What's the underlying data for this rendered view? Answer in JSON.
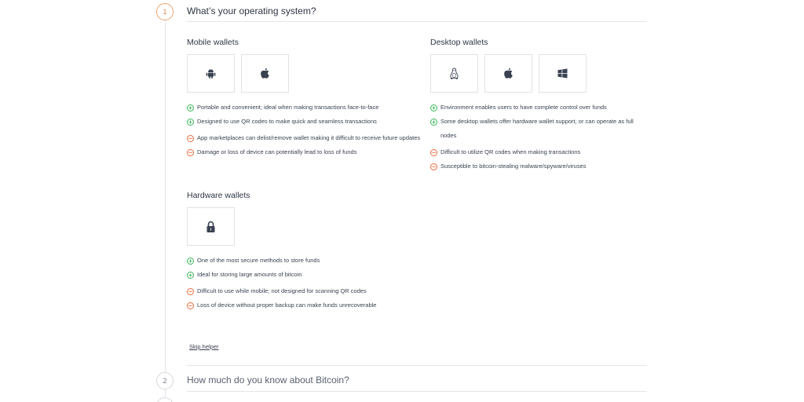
{
  "step1": {
    "number": "1",
    "title": "What’s your operating system?"
  },
  "step2": {
    "number": "2",
    "title": "How much do you know about Bitcoin?"
  },
  "mobile": {
    "title": "Mobile wallets",
    "icons": [
      "android-icon",
      "apple-icon"
    ],
    "pros": [
      "Portable and convenient; ideal when making transactions face-to-face",
      "Designed to use QR codes to make quick and seamless transactions"
    ],
    "cons": [
      "App marketplaces can delist/remove wallet making it difficult to receive future updates",
      "Damage or loss of device can potentially lead to loss of funds"
    ]
  },
  "desktop": {
    "title": "Desktop wallets",
    "icons": [
      "linux-icon",
      "apple-icon",
      "windows-icon"
    ],
    "pros": [
      "Environment enables users to have complete control over funds",
      "Some desktop wallets offer hardware wallet support, or can operate as full nodes"
    ],
    "cons": [
      "Difficult to utilize QR codes when making transactions",
      "Susceptible to bitcoin-stealing malware/spyware/viruses"
    ]
  },
  "hardware": {
    "title": "Hardware wallets",
    "icons": [
      "lock-icon"
    ],
    "pros": [
      "One of the most secure methods to store funds",
      "Ideal for storing large amounts of bitcoin"
    ],
    "cons": [
      "Difficult to use while mobile; not designed for scanning QR codes",
      "Loss of device without proper backup can make funds unrecoverable"
    ]
  },
  "skip_label": "Skip helper",
  "colors": {
    "accent": "#e8834a",
    "pro": "#3cb55a",
    "con": "#ef6a3c",
    "text": "#3a4250"
  }
}
